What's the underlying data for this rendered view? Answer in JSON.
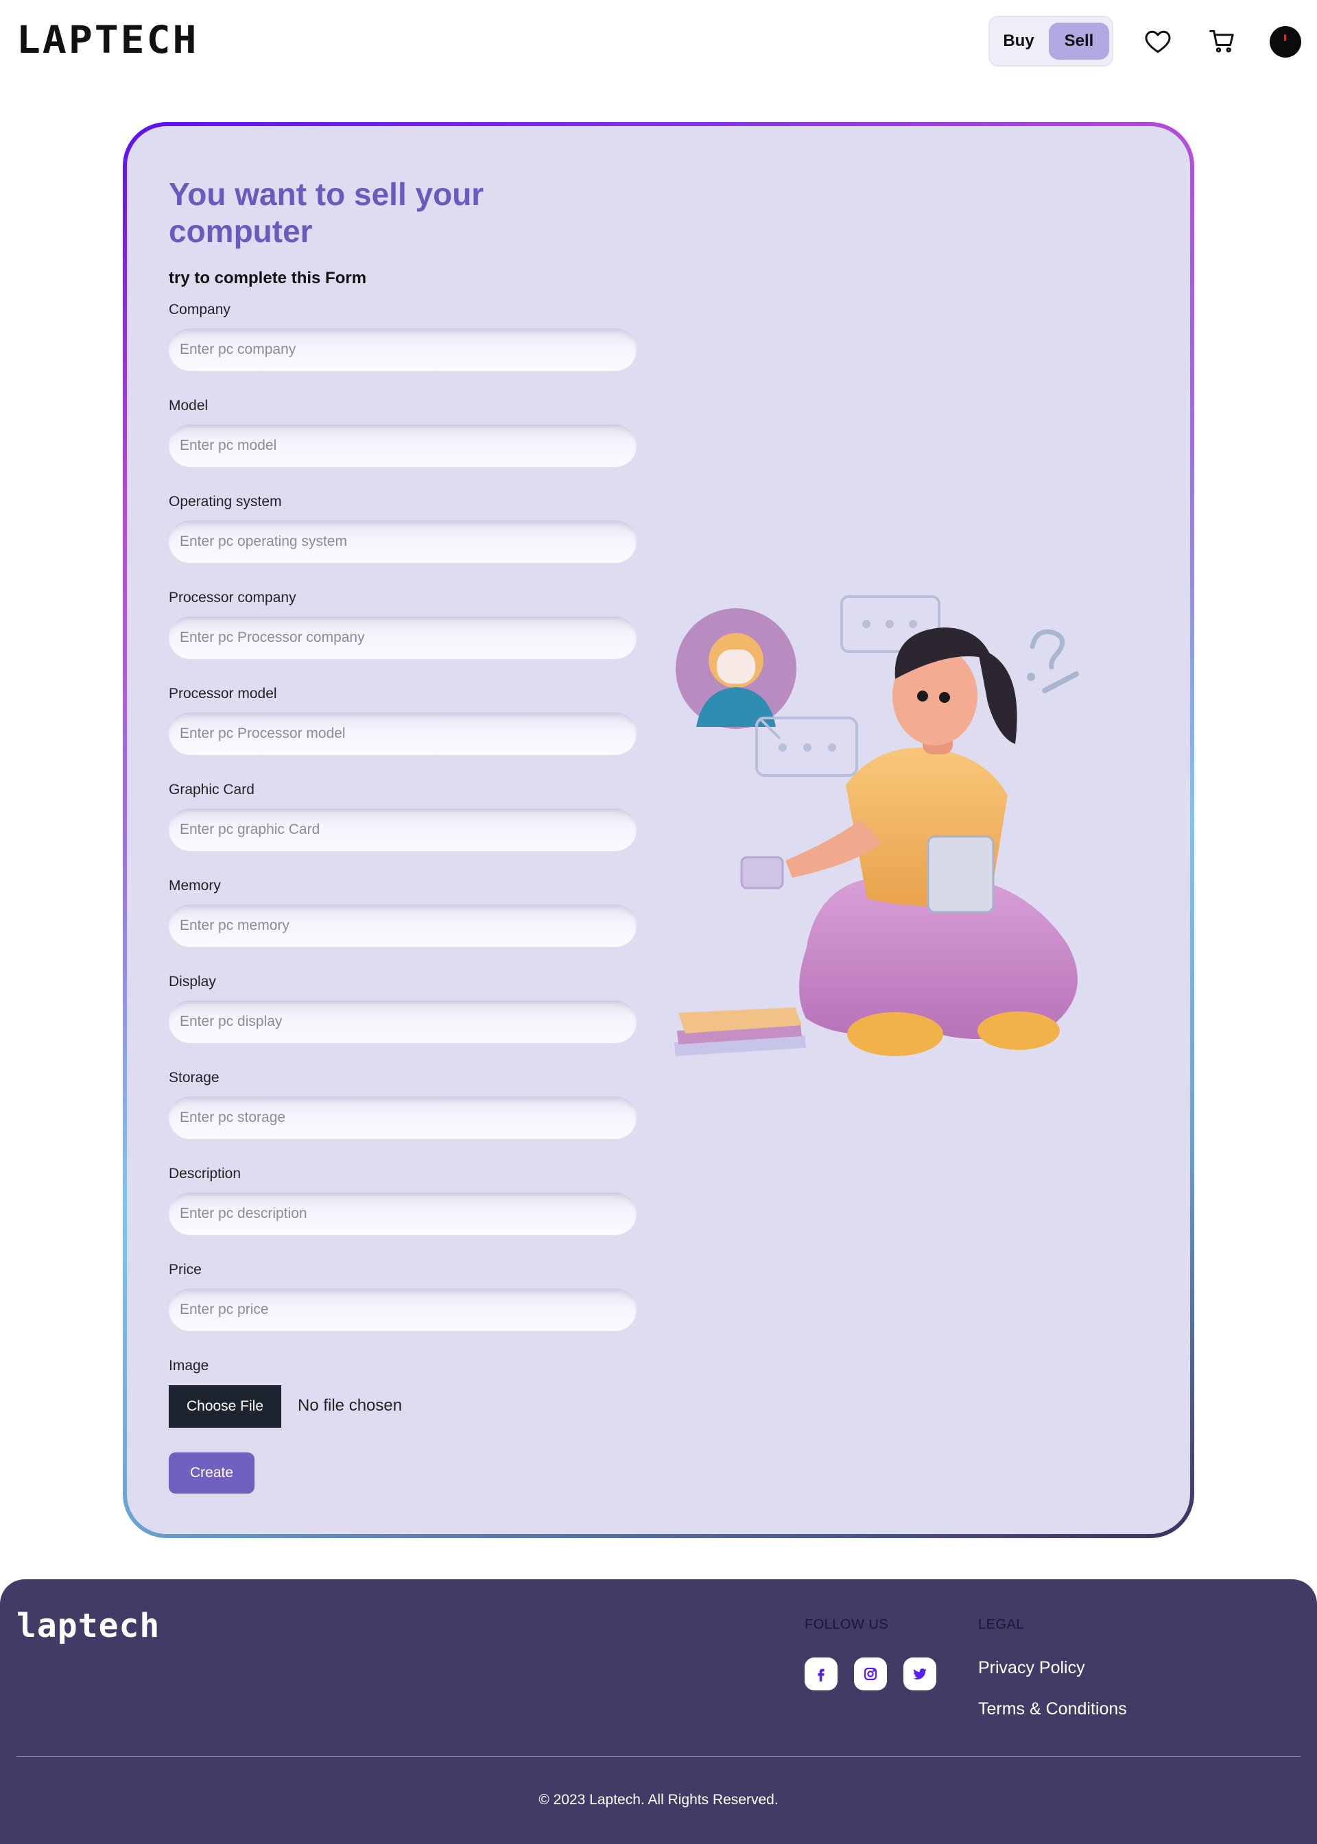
{
  "header": {
    "logo": "LAPTECH",
    "toggle": {
      "buy_label": "Buy",
      "sell_label": "Sell",
      "selected": "Sell"
    }
  },
  "form": {
    "title": "You want to sell your computer",
    "subtitle": "try to complete this Form",
    "fields": [
      {
        "label": "Company",
        "placeholder": "Enter pc company"
      },
      {
        "label": "Model",
        "placeholder": "Enter pc model"
      },
      {
        "label": "Operating system",
        "placeholder": "Enter pc operating system"
      },
      {
        "label": "Processor company",
        "placeholder": "Enter pc Processor company"
      },
      {
        "label": "Processor model",
        "placeholder": "Enter pc Processor model"
      },
      {
        "label": "Graphic Card",
        "placeholder": "Enter pc graphic Card"
      },
      {
        "label": "Memory",
        "placeholder": "Enter pc memory"
      },
      {
        "label": "Display",
        "placeholder": "Enter pc display"
      },
      {
        "label": "Storage",
        "placeholder": "Enter pc storage"
      },
      {
        "label": "Description",
        "placeholder": "Enter pc description"
      },
      {
        "label": "Price",
        "placeholder": "Enter pc price"
      }
    ],
    "image": {
      "label": "Image",
      "button_label": "Choose File",
      "status": "No file chosen"
    },
    "submit_label": "Create"
  },
  "footer": {
    "logo": "laptech",
    "follow_heading": "FOLLOW US",
    "social": [
      "facebook-icon",
      "instagram-icon",
      "twitter-icon"
    ],
    "legal_heading": "LEGAL",
    "legal_links": [
      "Privacy Policy",
      "Terms & Conditions"
    ],
    "copyright": "© 2023 Laptech. All Rights Reserved."
  },
  "colors": {
    "accent": "#7160c0",
    "title": "#6a5abd",
    "card_bg": "#dedcf0",
    "footer_bg": "#443a66",
    "toggle_selected": "#b2a9e2",
    "social_icon": "#5a1df0"
  }
}
